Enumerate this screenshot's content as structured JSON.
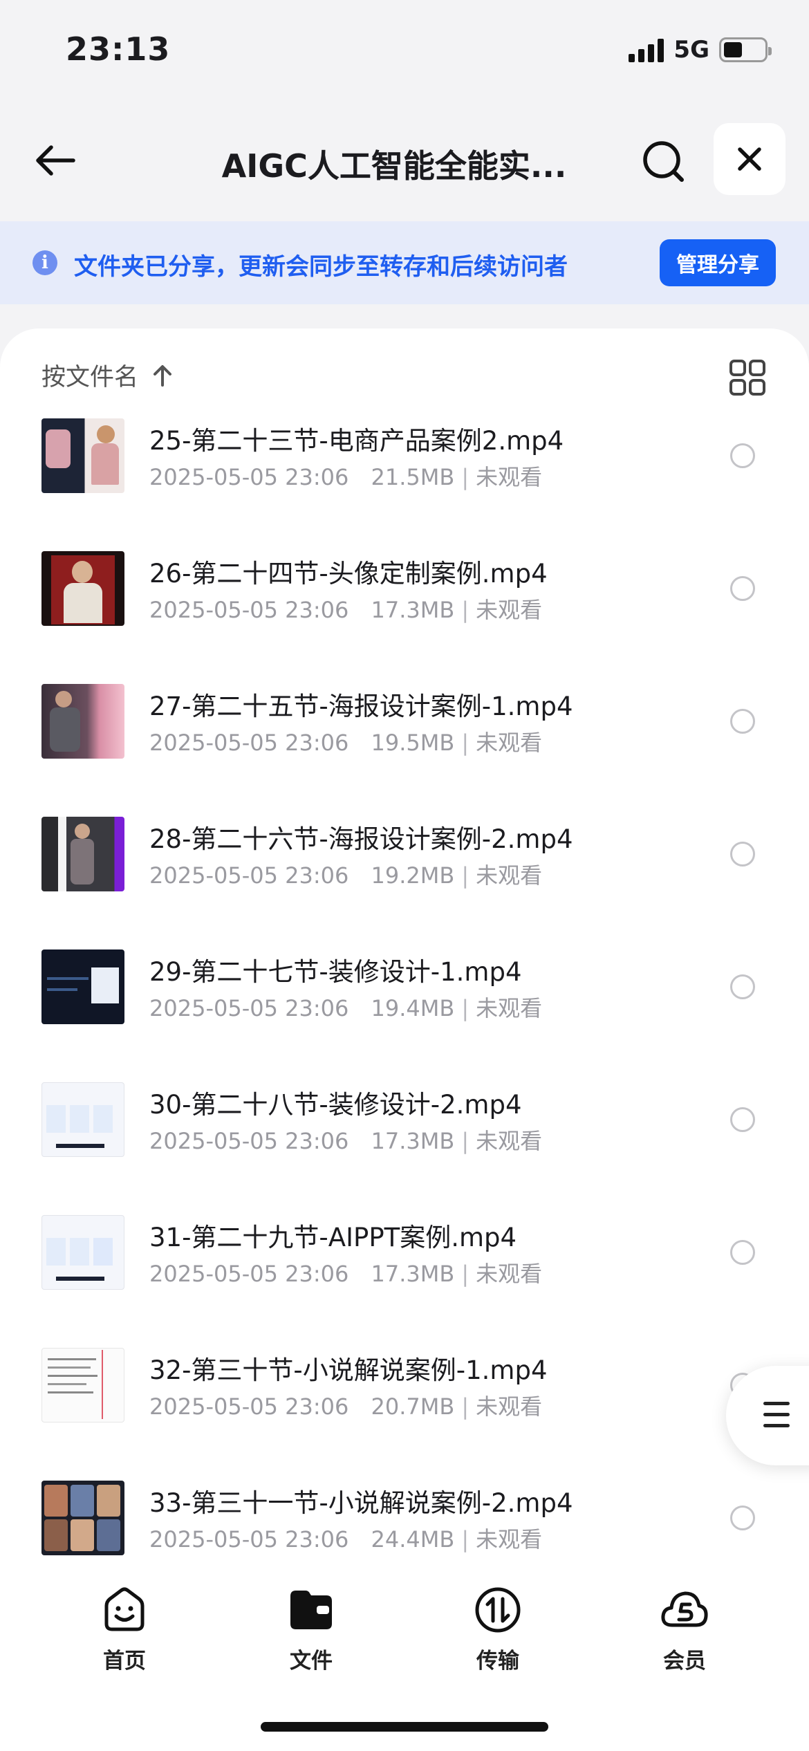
{
  "status_bar": {
    "time": "23:13",
    "network": "5G"
  },
  "nav": {
    "title": "AIGC人工智能全能实...",
    "icons": {
      "back": "arrow-left-icon",
      "search": "search-icon",
      "close": "close-icon"
    }
  },
  "share_banner": {
    "text": "文件夹已分享，更新会同步至转存和后续访问者",
    "button": "管理分享",
    "icon": "info-icon",
    "accent": "#1661f5"
  },
  "sort": {
    "label": "按文件名",
    "direction_icon": "arrow-up-icon",
    "view_toggle_icon": "grid-view-icon"
  },
  "files": [
    {
      "name": "25-第二十三节-电商产品案例2.mp4",
      "date": "2025-05-05 23:06",
      "size": "21.5MB",
      "status": "未观看"
    },
    {
      "name": "26-第二十四节-头像定制案例.mp4",
      "date": "2025-05-05 23:06",
      "size": "17.3MB",
      "status": "未观看"
    },
    {
      "name": "27-第二十五节-海报设计案例-1.mp4",
      "date": "2025-05-05 23:06",
      "size": "19.5MB",
      "status": "未观看"
    },
    {
      "name": "28-第二十六节-海报设计案例-2.mp4",
      "date": "2025-05-05 23:06",
      "size": "19.2MB",
      "status": "未观看"
    },
    {
      "name": "29-第二十七节-装修设计-1.mp4",
      "date": "2025-05-05 23:06",
      "size": "19.4MB",
      "status": "未观看"
    },
    {
      "name": "30-第二十八节-装修设计-2.mp4",
      "date": "2025-05-05 23:06",
      "size": "17.3MB",
      "status": "未观看"
    },
    {
      "name": "31-第二十九节-AIPPT案例.mp4",
      "date": "2025-05-05 23:06",
      "size": "17.3MB",
      "status": "未观看"
    },
    {
      "name": "32-第三十节-小说解说案例-1.mp4",
      "date": "2025-05-05 23:06",
      "size": "20.7MB",
      "status": "未观看"
    },
    {
      "name": "33-第三十一节-小说解说案例-2.mp4",
      "date": "2025-05-05 23:06",
      "size": "24.4MB",
      "status": "未观看"
    }
  ],
  "float_menu_icon": "menu-icon",
  "tabs": [
    {
      "label": "首页",
      "icon": "home-smile-icon"
    },
    {
      "label": "文件",
      "icon": "folder-icon"
    },
    {
      "label": "传输",
      "icon": "transfer-icon"
    },
    {
      "label": "会员",
      "icon": "member-cloud-icon"
    }
  ]
}
